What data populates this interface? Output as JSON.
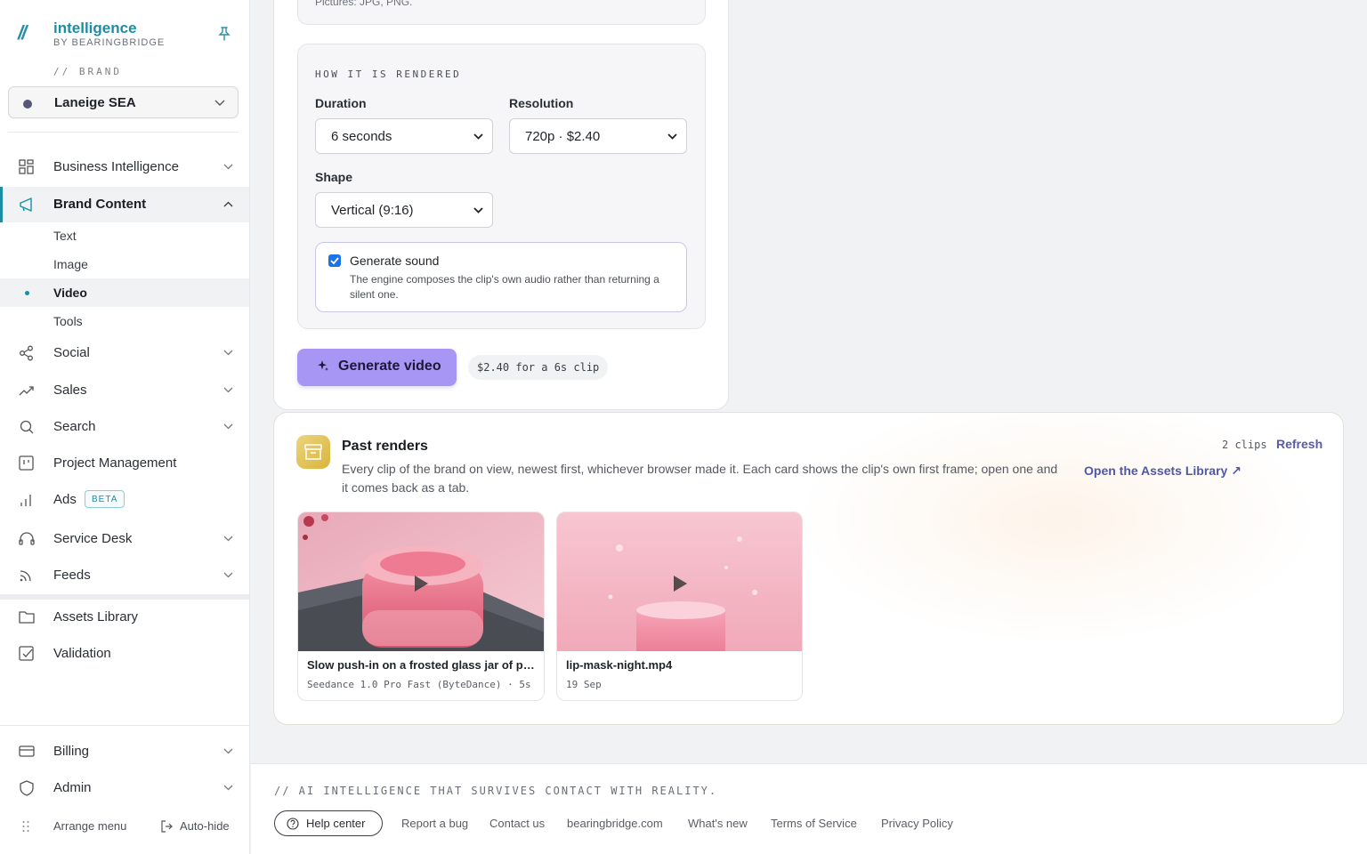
{
  "sidebar": {
    "logo": {
      "mark": "//",
      "name": "intelligence",
      "sub": "BY BEARINGBRIDGE"
    },
    "brand_label": "// BRAND",
    "brand_value": "Laneige SEA",
    "nav": [
      {
        "label": "Business Intelligence",
        "icon": "grid-icon"
      },
      {
        "label": "Brand Content",
        "icon": "megaphone-icon"
      },
      {
        "label": "Social",
        "icon": "share-icon"
      },
      {
        "label": "Sales",
        "icon": "trend-icon"
      },
      {
        "label": "Search",
        "icon": "search-icon"
      },
      {
        "label": "Project Management",
        "icon": "board-icon"
      },
      {
        "label": "Ads",
        "icon": "bar-chart-icon",
        "badge": "BETA"
      },
      {
        "label": "Service Desk",
        "icon": "headset-icon"
      },
      {
        "label": "Feeds",
        "icon": "rss-icon"
      },
      {
        "label": "Assets Library",
        "icon": "folder-icon"
      },
      {
        "label": "Validation",
        "icon": "check-square-icon"
      },
      {
        "label": "Billing",
        "icon": "card-icon"
      },
      {
        "label": "Admin",
        "icon": "shield-icon"
      }
    ],
    "sub_items": [
      "Text",
      "Image",
      "Video",
      "Tools"
    ],
    "arrange_menu": "Arrange menu",
    "auto_hide": "Auto-hide"
  },
  "upload": {
    "hint_tail": "Pictures: JPG, PNG."
  },
  "render": {
    "section_title": "HOW IT IS RENDERED",
    "duration_label": "Duration",
    "duration_value": "6 seconds",
    "resolution_label": "Resolution",
    "resolution_value": "720p · $2.40",
    "shape_label": "Shape",
    "shape_value": "Vertical (9:16)",
    "sound_title": "Generate sound",
    "sound_checked": true,
    "sound_desc": "The engine composes the clip's own audio rather than returning a silent one.",
    "generate_label": "Generate video",
    "cost": "$2.40 for a 6s clip"
  },
  "past": {
    "title": "Past renders",
    "desc": "Every clip of the brand on view, newest first, whichever browser made it. Each card shows the clip's own first frame; open one and it comes back as a tab.",
    "assets_link": "Open the Assets Library ↗",
    "clip_count": "2 clips",
    "refresh": "Refresh",
    "clips": [
      {
        "title": "Slow push-in on a frosted glass jar of pink lip mask",
        "meta": "Seedance 1.0 Pro Fast (ByteDance) · 5s"
      },
      {
        "title": "lip-mask-night.mp4",
        "meta": "19 Sep"
      }
    ]
  },
  "footer": {
    "tagline": "// AI INTELLIGENCE THAT SURVIVES CONTACT WITH REALITY.",
    "help": "Help center",
    "links": [
      "Report a bug",
      "Contact us",
      "bearingbridge.com",
      "What's new",
      "Terms of Service",
      "Privacy Policy"
    ]
  },
  "colors": {
    "accent": "#1b8ea6",
    "primary_button": "#a896f4",
    "link": "#4e58a8"
  }
}
